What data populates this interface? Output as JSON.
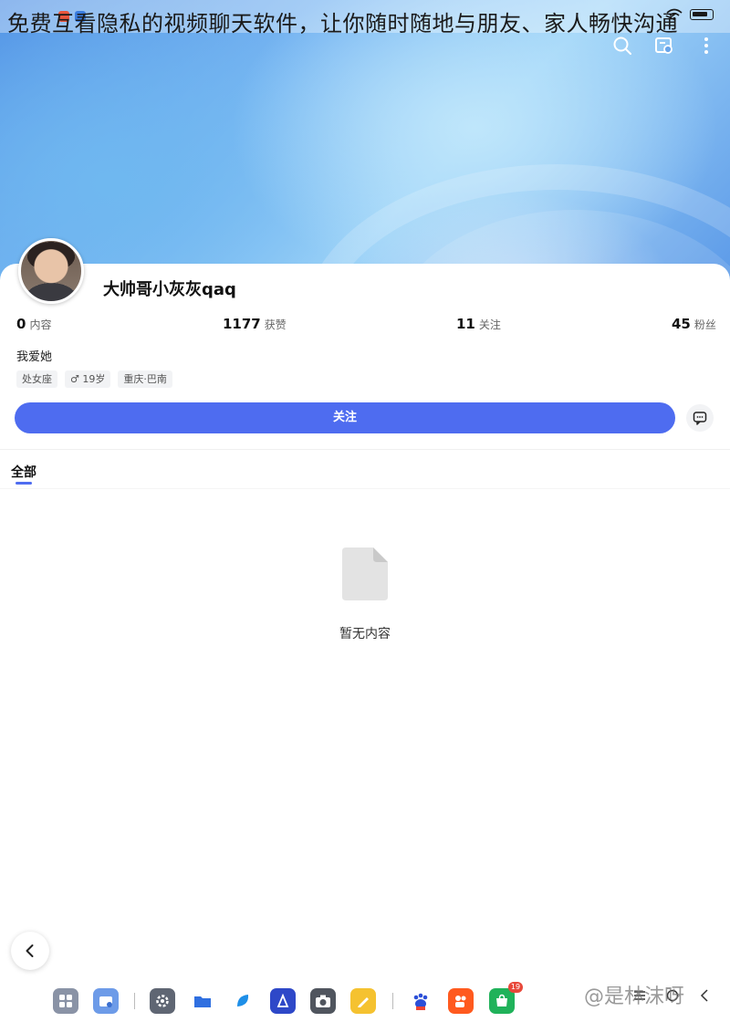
{
  "overlay_caption": "免费互看隐私的视频聊天软件，让你随时随地与朋友、家人畅快沟通",
  "status_bar": {
    "time": ""
  },
  "profile": {
    "nickname": "大帅哥小灰灰qaq",
    "bio": "我爱她",
    "stats": [
      {
        "value": "0",
        "label": "内容"
      },
      {
        "value": "1177",
        "label": "获赞"
      },
      {
        "value": "11",
        "label": "关注"
      },
      {
        "value": "45",
        "label": "粉丝"
      }
    ],
    "tags": [
      "处女座",
      "♂ 19岁",
      "重庆·巴南"
    ]
  },
  "actions": {
    "follow_label": "关注"
  },
  "tabs": [
    {
      "label": "全部",
      "active": true
    }
  ],
  "empty_state": {
    "text": "暂无内容"
  },
  "dock": {
    "apps": [
      "app-grid-icon",
      "files-icon",
      "settings-icon",
      "file-manager-icon",
      "browser-icon",
      "app-store-icon",
      "camera-icon",
      "notes-icon",
      "baidu-icon",
      "kuaishou-icon",
      "shop-icon"
    ],
    "shop_badge": "19"
  },
  "watermark": "@是林沫呀",
  "colors": {
    "accent": "#4e6cf0",
    "background": "#ffffff"
  }
}
